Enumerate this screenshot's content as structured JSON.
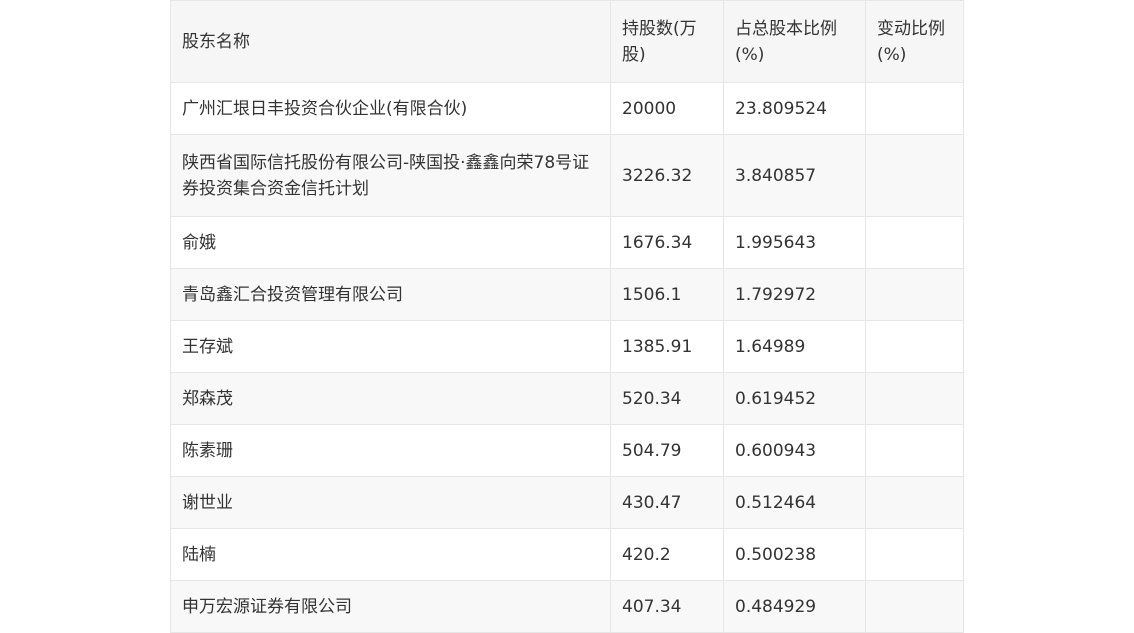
{
  "table": {
    "headers": [
      "股东名称",
      "持股数(万股)",
      "占总股本比例(%)",
      "变动比例(%)"
    ],
    "rows": [
      [
        "广州汇垠日丰投资合伙企业(有限合伙)",
        "20000",
        "23.809524",
        ""
      ],
      [
        "陕西省国际信托股份有限公司-陕国投·鑫鑫向荣78号证券投资集合资金信托计划",
        "3226.32",
        "3.840857",
        ""
      ],
      [
        "俞娥",
        "1676.34",
        "1.995643",
        ""
      ],
      [
        "青岛鑫汇合投资管理有限公司",
        "1506.1",
        "1.792972",
        ""
      ],
      [
        "王存斌",
        "1385.91",
        "1.64989",
        ""
      ],
      [
        "郑森茂",
        "520.34",
        "0.619452",
        ""
      ],
      [
        "陈素珊",
        "504.79",
        "0.600943",
        ""
      ],
      [
        "谢世业",
        "430.47",
        "0.512464",
        ""
      ],
      [
        "陆楠",
        "420.2",
        "0.500238",
        ""
      ],
      [
        "申万宏源证券有限公司",
        "407.34",
        "0.484929",
        ""
      ]
    ]
  }
}
